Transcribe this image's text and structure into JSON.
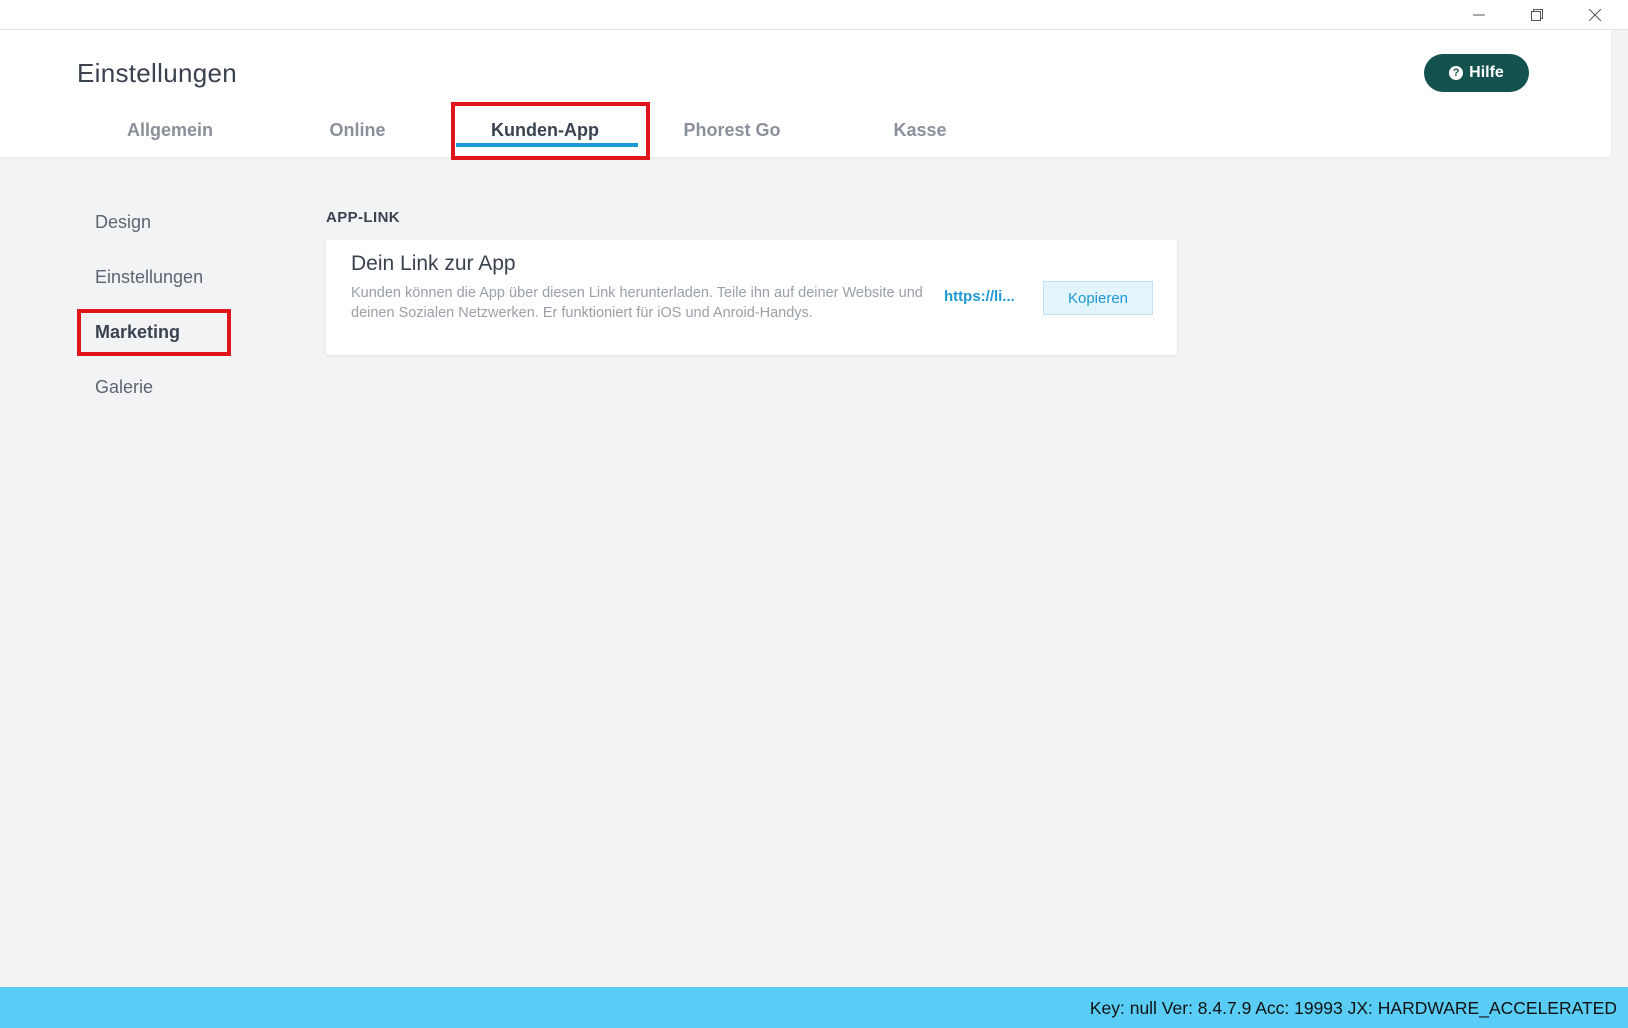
{
  "window": {
    "controls": [
      "minimize-icon",
      "restore-icon",
      "close-icon"
    ]
  },
  "header": {
    "title": "Einstellungen",
    "help_label": "Hilfe",
    "help_icon_glyph": "?"
  },
  "tabs": [
    {
      "label": "Allgemein",
      "active": false
    },
    {
      "label": "Online",
      "active": false
    },
    {
      "label": "Kunden-App",
      "active": true
    },
    {
      "label": "Phorest Go",
      "active": false
    },
    {
      "label": "Kasse",
      "active": false
    }
  ],
  "subnav": [
    {
      "label": "Design",
      "active": false
    },
    {
      "label": "Einstellungen",
      "active": false
    },
    {
      "label": "Marketing",
      "active": true
    },
    {
      "label": "Galerie",
      "active": false
    }
  ],
  "section": {
    "heading": "APP-LINK",
    "card": {
      "title": "Dein Link zur App",
      "description": "Kunden können die App über diesen Link herunterladen. Teile ihn auf deiner Website und deinen Sozialen Netzwerken. Er funktioniert für iOS und Anroid-Handys.",
      "link_text": "https://li...",
      "copy_label": "Kopieren"
    }
  },
  "statusbar": {
    "text": "Key: null Ver: 8.4.7.9 Acc: 19993  JX: HARDWARE_ACCELERATED"
  },
  "colors": {
    "accent": "#1d9ad6",
    "help_button": "#14524f",
    "highlight": "#e0141b",
    "statusbar": "#5acdf6",
    "background": "#f2f3f5"
  }
}
